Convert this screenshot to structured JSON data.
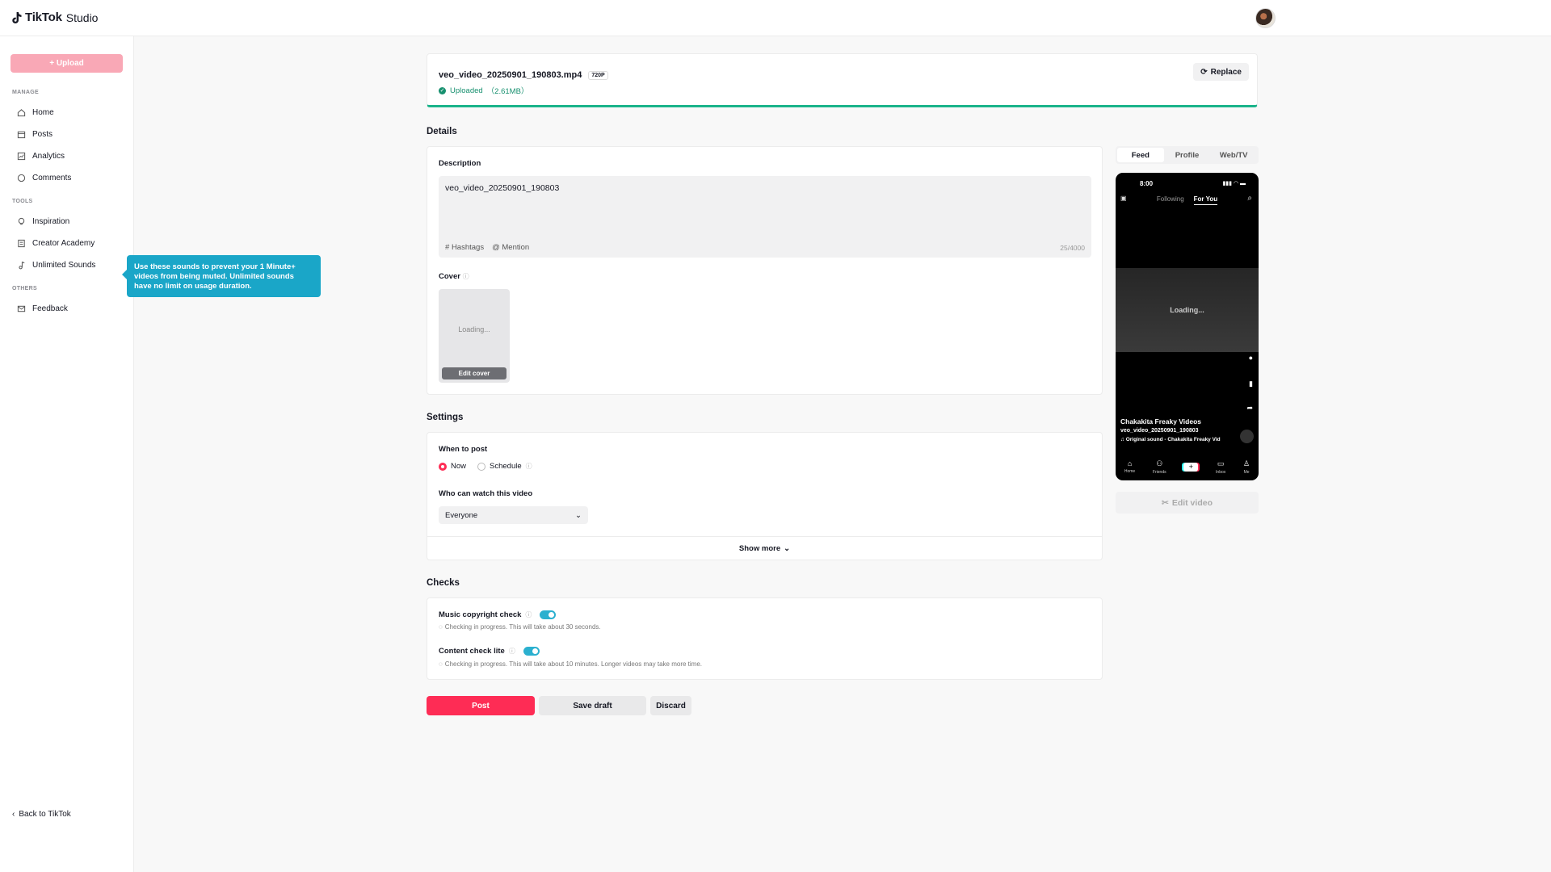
{
  "header": {
    "logo_text": "TikTok",
    "logo_sub": "Studio"
  },
  "sidebar": {
    "upload_label": "+ Upload",
    "sections": {
      "manage": "MANAGE",
      "tools": "TOOLS",
      "others": "OTHERS"
    },
    "items": {
      "home": "Home",
      "posts": "Posts",
      "analytics": "Analytics",
      "comments": "Comments",
      "inspiration": "Inspiration",
      "creator_academy": "Creator Academy",
      "unlimited_sounds": "Unlimited Sounds",
      "feedback": "Feedback"
    },
    "back_label": "Back to TikTok"
  },
  "tooltip": {
    "text": "Use these sounds to prevent your 1 Minute+ videos from being muted. Unlimited sounds have no limit on usage duration."
  },
  "file": {
    "name": "veo_video_20250901_190803.mp4",
    "resolution": "720P",
    "status": "Uploaded",
    "size": "（2.61MB）",
    "replace_label": "Replace",
    "upload_progress_percent": 100
  },
  "details": {
    "title": "Details",
    "description_label": "Description",
    "description_value": "veo_video_20250901_190803",
    "hashtags_label": "Hashtags",
    "mention_label": "Mention",
    "char_count": "25/4000",
    "cover_label": "Cover",
    "cover_loading": "Loading...",
    "edit_cover_label": "Edit cover"
  },
  "settings": {
    "title": "Settings",
    "when_label": "When to post",
    "now_label": "Now",
    "schedule_label": "Schedule",
    "selected": "Now",
    "who_label": "Who can watch this video",
    "who_value": "Everyone",
    "show_more": "Show more"
  },
  "checks": {
    "title": "Checks",
    "music_label": "Music copyright check",
    "music_status": "Checking in progress. This will take about 30 seconds.",
    "content_label": "Content check lite",
    "content_status": "Checking in progress. This will take about 10 minutes. Longer videos may take more time."
  },
  "actions": {
    "post": "Post",
    "save_draft": "Save draft",
    "discard": "Discard"
  },
  "preview": {
    "tabs": [
      "Feed",
      "Profile",
      "Web/TV"
    ],
    "active_tab": "Feed",
    "time": "8:00",
    "nav_following": "Following",
    "nav_for_you": "For You",
    "loading": "Loading...",
    "author": "Chakakita Freaky Videos",
    "caption": "veo_video_20250901_190803",
    "sound": "Original sound - Chakakita Freaky Vid",
    "tabbar": [
      "Home",
      "Friends",
      "",
      "Inbox",
      "Me"
    ],
    "edit_video_label": "Edit video"
  },
  "colors": {
    "brand": "#fe2c55",
    "accent": "#2bb0cf",
    "success": "#17906f"
  }
}
